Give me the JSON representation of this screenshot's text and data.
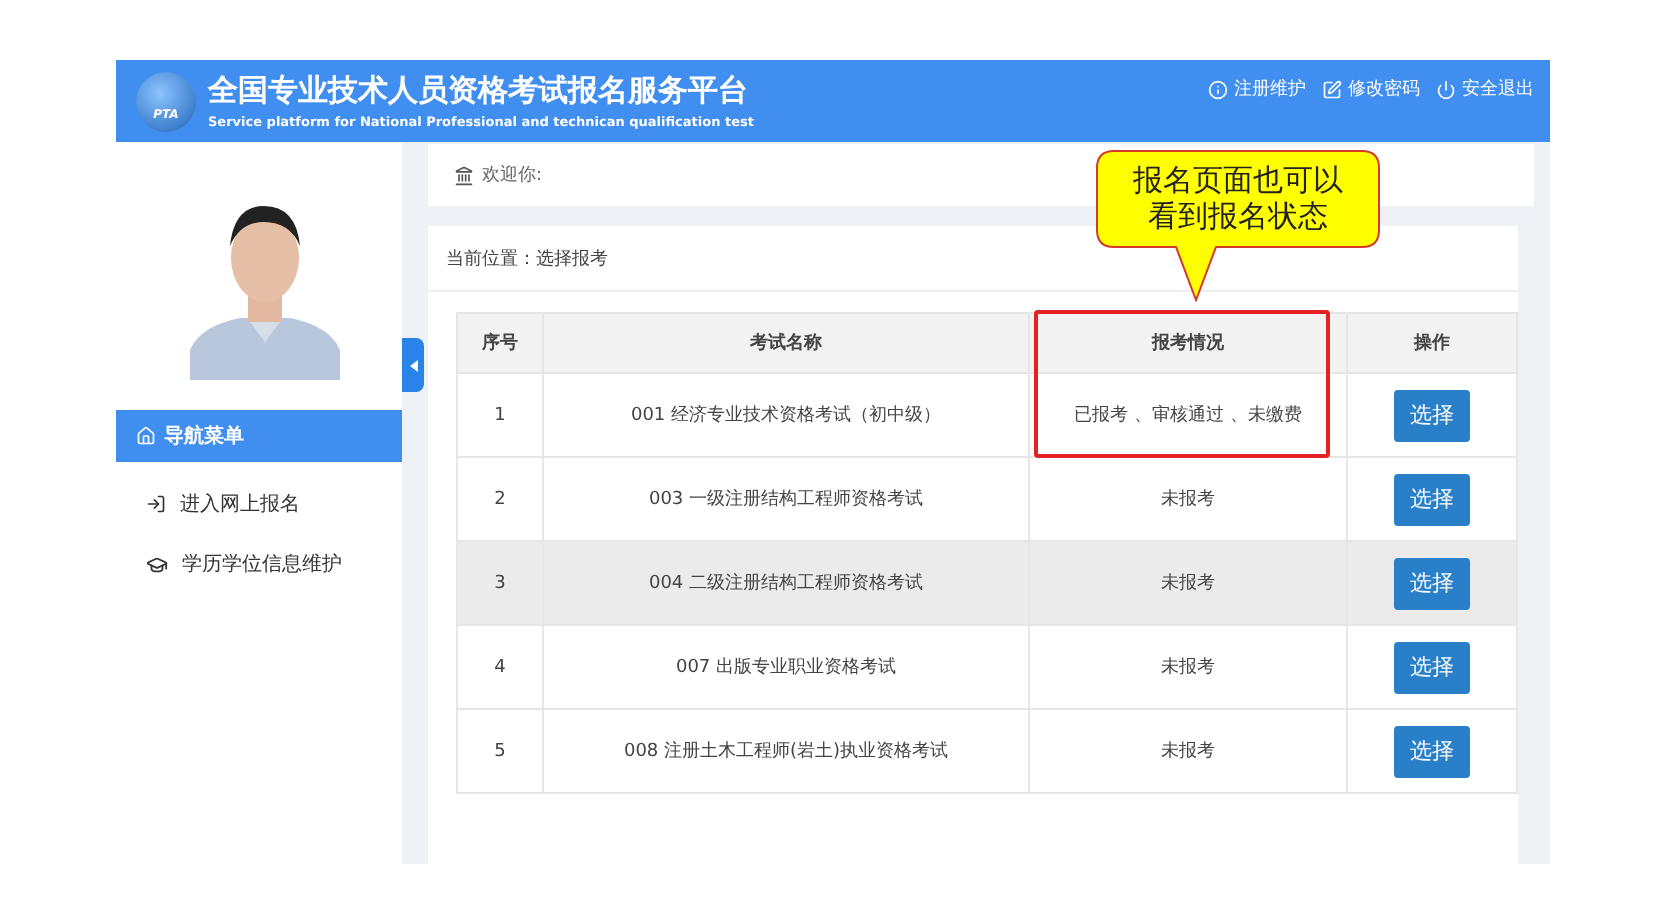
{
  "header": {
    "title": "全国专业技术人员资格考试报名服务平台",
    "subtitle": "Service platform for National Professional and technican qualification test",
    "logo_text": "PTA",
    "links": [
      {
        "label": "注册维护"
      },
      {
        "label": "修改密码"
      },
      {
        "label": "安全退出"
      }
    ]
  },
  "sidebar": {
    "menu_title": "导航菜单",
    "items": [
      {
        "label": "进入网上报名"
      },
      {
        "label": "学历学位信息维护"
      }
    ]
  },
  "welcome": "欢迎你:",
  "breadcrumb": "当前位置：选择报考",
  "table": {
    "columns": [
      "序号",
      "考试名称",
      "报考情况",
      "操作"
    ],
    "rows": [
      {
        "cells": [
          "1",
          "001 经济专业技术资格考试（初中级）",
          "已报考 、审核通过 、未缴费"
        ],
        "action": "选择",
        "highlighted": false
      },
      {
        "cells": [
          "2",
          "003 一级注册结构工程师资格考试",
          "未报考"
        ],
        "action": "选择",
        "highlighted": false
      },
      {
        "cells": [
          "3",
          "004 二级注册结构工程师资格考试",
          "未报考"
        ],
        "action": "选择",
        "highlighted": true
      },
      {
        "cells": [
          "4",
          "007 出版专业职业资格考试",
          "未报考"
        ],
        "action": "选择",
        "highlighted": false
      },
      {
        "cells": [
          "5",
          "008 注册土木工程师(岩土)执业资格考试",
          "未报考"
        ],
        "action": "选择",
        "highlighted": false
      }
    ]
  },
  "annotation": {
    "text": "报名页面也可以看到报名状态"
  }
}
